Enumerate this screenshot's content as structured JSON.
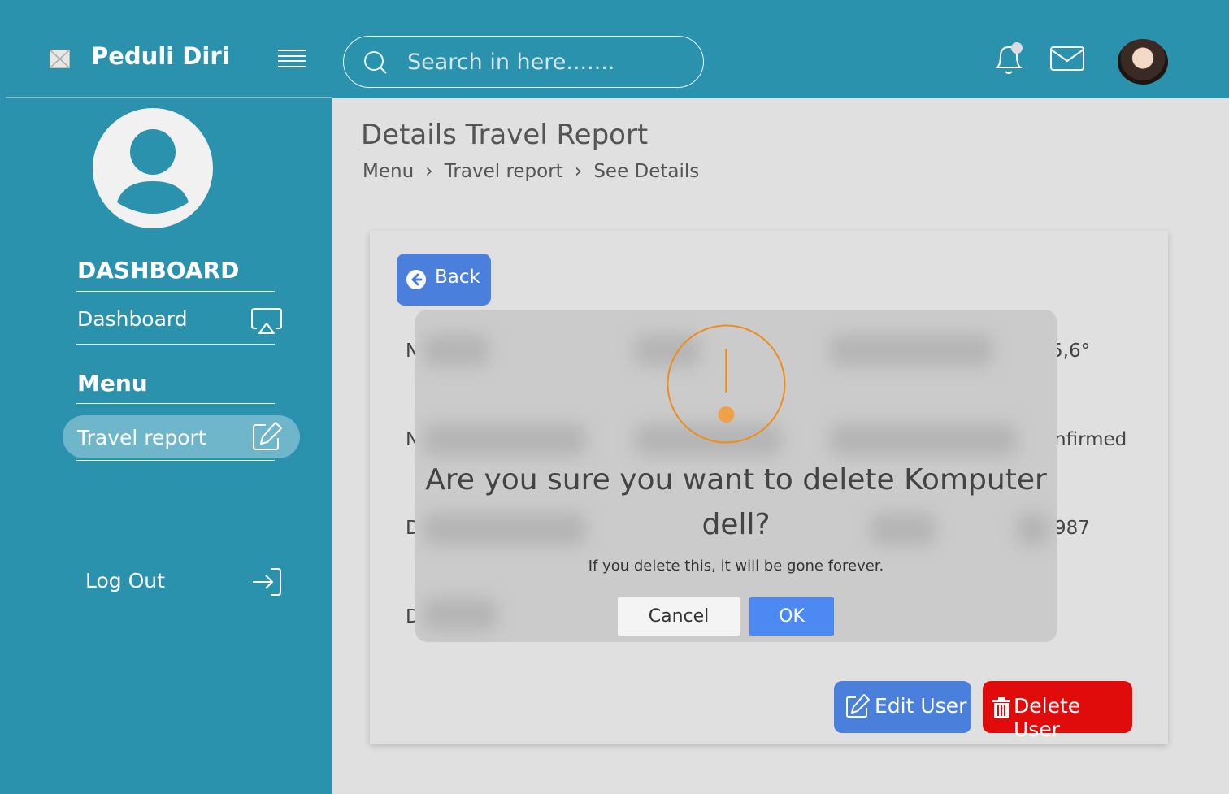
{
  "app": {
    "brand_name": "Peduli Diri",
    "accent_color": "#2a92ad"
  },
  "header": {
    "search_placeholder": "Search in here.......",
    "icons": [
      "menu-icon",
      "search-icon",
      "bell-icon",
      "mail-icon"
    ]
  },
  "sidebar": {
    "section_dashboard": "DASHBOARD",
    "item_dashboard": "Dashboard",
    "section_menu": "Menu",
    "item_travel_report": "Travel report",
    "item_logout": "Log Out"
  },
  "main": {
    "page_title": "Details Travel Report",
    "breadcrumb": [
      "Menu",
      "Travel report",
      "See Details"
    ],
    "back_label": "Back",
    "edge_texts": [
      "N",
      "N",
      "D",
      "D",
      "5,6°",
      "nfirmed",
      "987"
    ],
    "edit_label": "Edit User",
    "delete_label": "Delete User"
  },
  "modal": {
    "title": "Are you sure you want to delete Komputer dell?",
    "message": "If you delete this, it will be gone forever.",
    "cancel_label": "Cancel",
    "ok_label": "OK",
    "icon": "warning-icon",
    "warning_color": "#f08c1a",
    "ok_color": "#4d89f2",
    "delete_color": "#e00c0c"
  }
}
